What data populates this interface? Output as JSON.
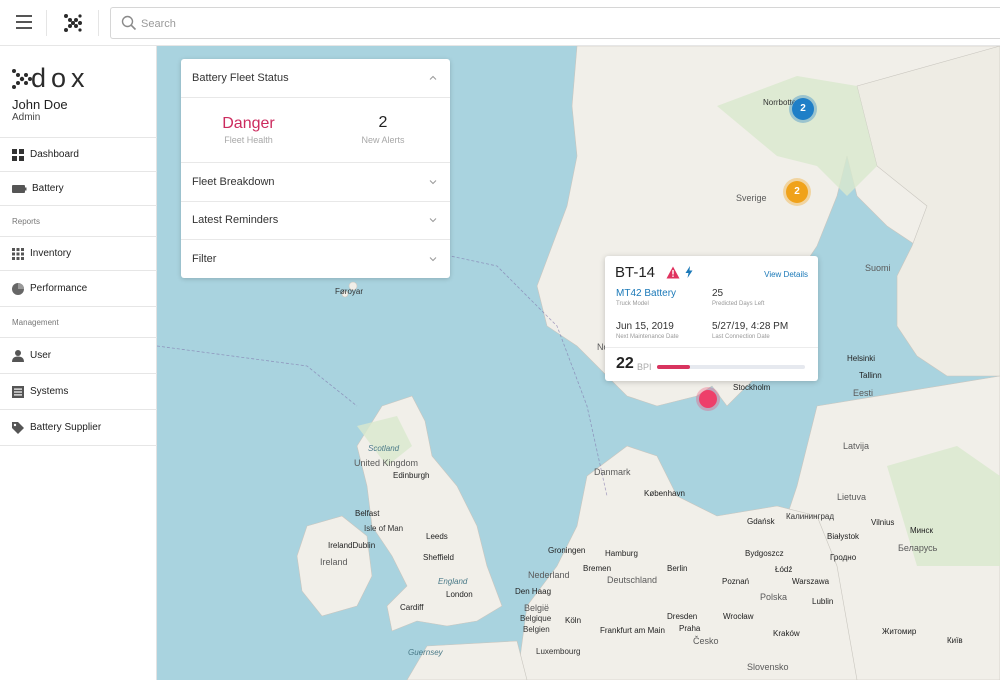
{
  "search": {
    "placeholder": "Search"
  },
  "brand": {
    "name": "dox"
  },
  "user": {
    "name": "John Doe",
    "role": "Admin"
  },
  "nav": {
    "dashboard": "Dashboard",
    "battery": "Battery",
    "reports_section": "Reports",
    "inventory": "Inventory",
    "performance": "Performance",
    "management_section": "Management",
    "user": "User",
    "systems": "Systems",
    "battery_supplier": "Battery Supplier"
  },
  "panel": {
    "title": "Battery Fleet Status",
    "fleet_health_value": "Danger",
    "fleet_health_label": "Fleet Health",
    "new_alerts_value": "2",
    "new_alerts_label": "New Alerts",
    "fleet_breakdown": "Fleet Breakdown",
    "latest_reminders": "Latest Reminders",
    "filter": "Filter"
  },
  "card": {
    "id": "BT-14",
    "view_details": "View Details",
    "truck_model_value": "MT42 Battery",
    "truck_model_label": "Truck Model",
    "predicted_days_value": "25",
    "predicted_days_label": "Predicted Days Left",
    "next_maintenance_value": "Jun 15, 2019",
    "next_maintenance_label": "Next Maintenance Date",
    "last_connection_value": "5/27/19, 4:28 PM",
    "last_connection_label": "Last Connection Date",
    "bpi_value": "22",
    "bpi_label": "BPI",
    "bpi_fraction": 0.22
  },
  "clusters": {
    "north": "2",
    "sverige": "2"
  },
  "map_labels": {
    "norrbotten": "Norrbotten",
    "sverige": "Sverige",
    "suomi": "Suomi",
    "faroyar": "Føroyar",
    "helsinki": "Helsinki",
    "tallinn": "Tallinn",
    "eesti": "Eesti",
    "stockholm": "Stockholm",
    "latvija": "Latvija",
    "lietuva": "Lietuva",
    "danmark": "Danmark",
    "kobenhavn": "København",
    "gdansk": "Gdańsk",
    "kaliningrad": "Калининград",
    "united_kingdom": "United Kingdom",
    "scotland": "Scotland",
    "edinburgh": "Edinburgh",
    "isle_of_man": "Isle of Man",
    "belfast": "Belfast",
    "ireland_dublin": "IrelandDublin",
    "ireland": "Ireland",
    "leeds": "Leeds",
    "sheffield": "Sheffield",
    "england": "England",
    "london": "London",
    "cardiff": "Cardiff",
    "groningen": "Groningen",
    "hamburg": "Hamburg",
    "bremen": "Bremen",
    "nederland": "Nederland",
    "deutschland": "Deutschland",
    "berlin": "Berlin",
    "poznan": "Poznań",
    "warszawa": "Warszawa",
    "bydgoszcz": "Bydgoszcz",
    "bialystok": "Białystok",
    "lublin": "Lublin",
    "lodz": "Łódź",
    "wroclaw": "Wrocław",
    "krakow": "Kraków",
    "cesko": "Česko",
    "slovensko": "Slovensko",
    "den_haag": "Den Haag",
    "belgie": "België",
    "belgique": "Belgique",
    "belgien": "Belgien",
    "koln": "Köln",
    "frankfurt": "Frankfurt am Main",
    "dresden": "Dresden",
    "praha": "Praha",
    "luxembourg": "Luxembourg",
    "polska": "Polska",
    "belarus": "Беларусь",
    "grodno": "Гродно",
    "minsk": "Минск",
    "zhytomyr": "Житомир",
    "kyiv": "Київ",
    "vilnius": "Vilnius",
    "guernsey": "Guernsey",
    "norge": "Norge"
  }
}
